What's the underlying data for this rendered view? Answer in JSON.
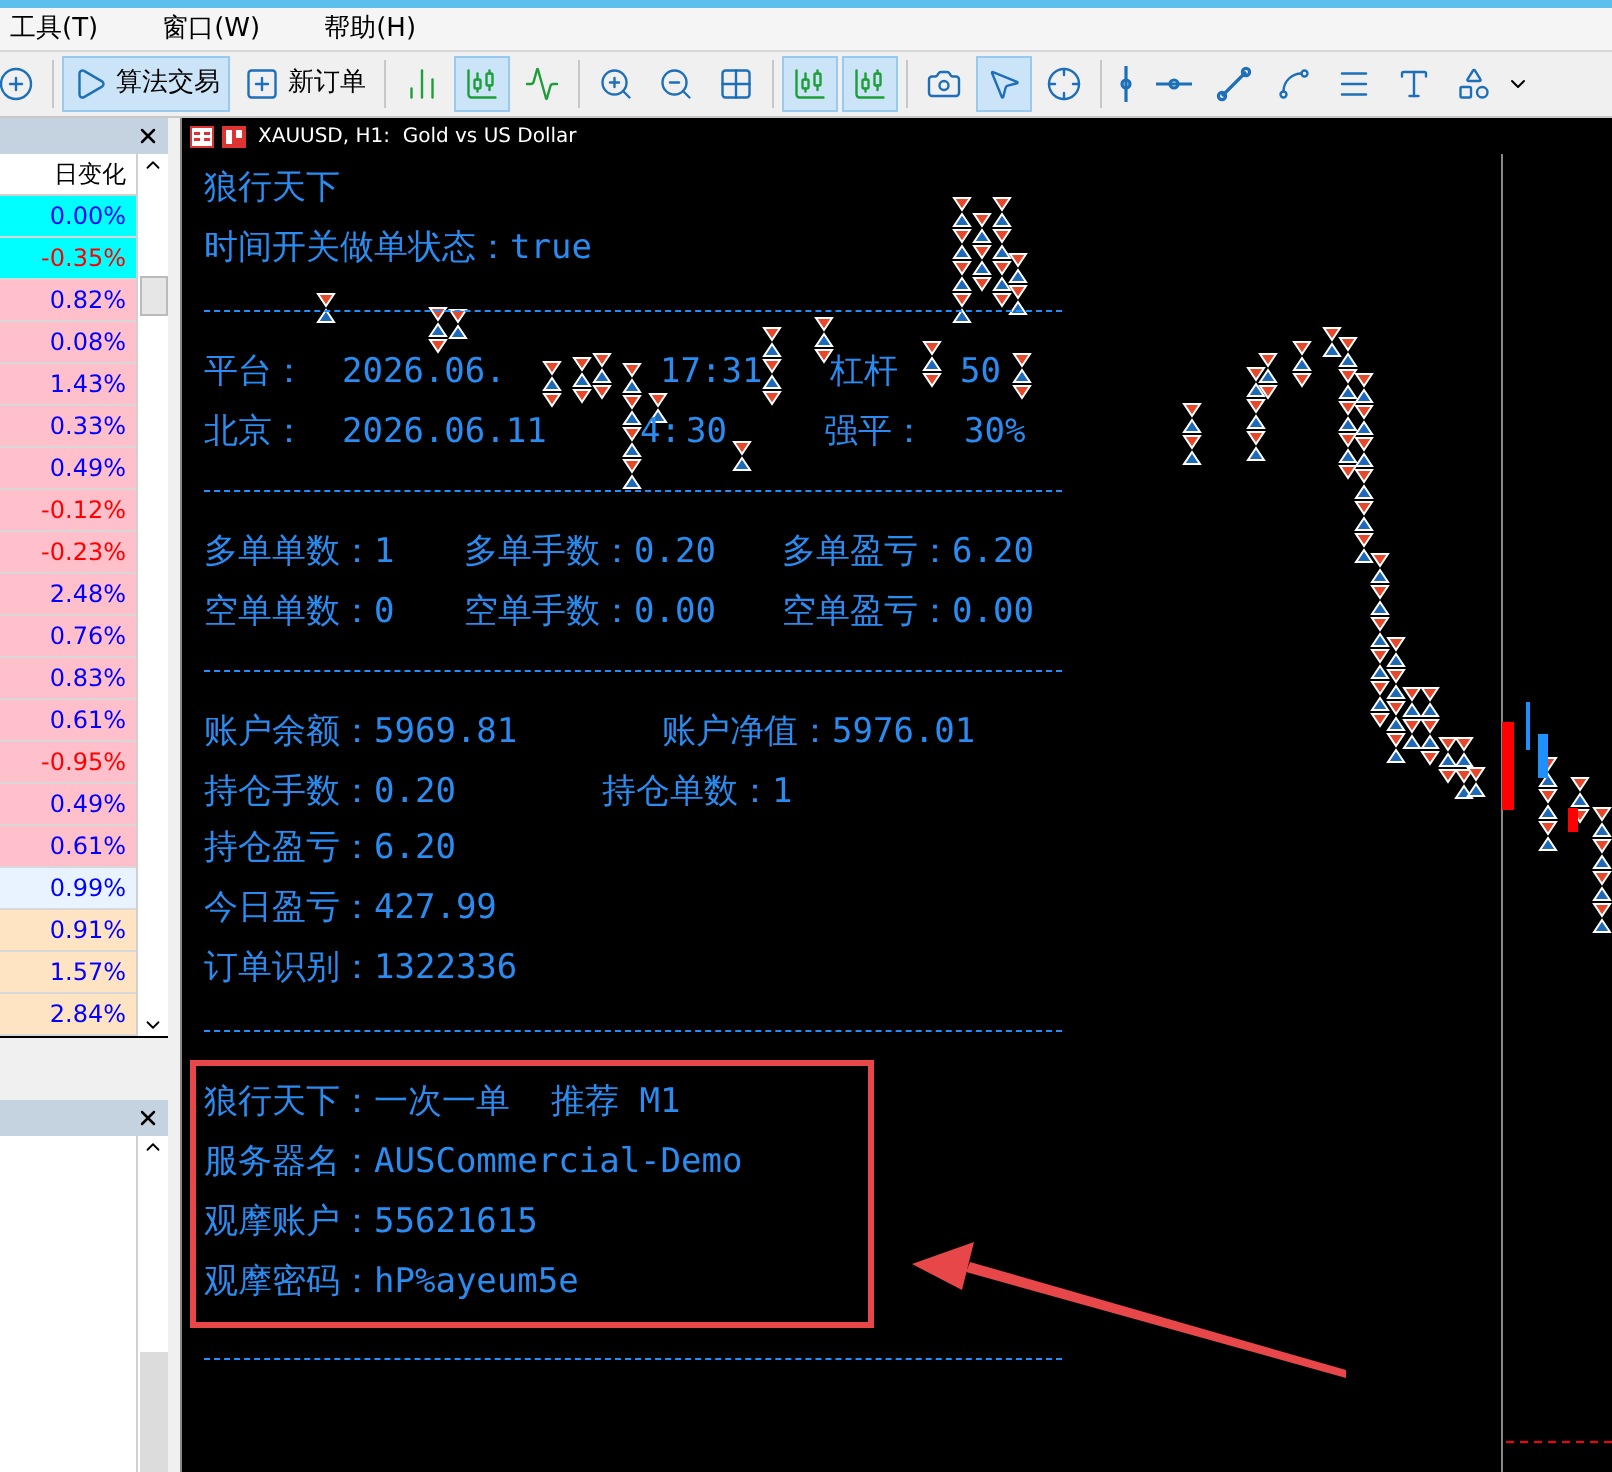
{
  "menu": [
    {
      "label": "工具(T)"
    },
    {
      "label": "窗口(W)"
    },
    {
      "label": "帮助(H)"
    }
  ],
  "toolbar": [
    {
      "selected": false
    },
    {
      "label": "算法交易",
      "selected": true
    },
    {
      "label": "新订单",
      "selected": false
    },
    {
      "selected": false
    },
    {
      "selected": true
    },
    {
      "selected": false
    },
    {
      "selected": false
    },
    {
      "selected": false
    },
    {
      "selected": false
    },
    {
      "selected": true
    },
    {
      "selected": true
    },
    {
      "selected": false
    },
    {
      "selected": true
    },
    {
      "selected": false
    },
    {
      "selected": false
    },
    {
      "selected": false
    },
    {
      "selected": false
    },
    {
      "selected": false
    },
    {
      "selected": false
    },
    {
      "selected": false
    },
    {
      "selected": false
    }
  ],
  "market_watch": {
    "column": "日变化",
    "rows": [
      {
        "value": "0.00%",
        "color": "#00ffff",
        "down": false
      },
      {
        "value": "-0.35%",
        "color": "#00ffff",
        "down": true
      },
      {
        "value": "0.82%",
        "color": "#ffc0cb",
        "down": false
      },
      {
        "value": "0.08%",
        "color": "#ffc0cb",
        "down": false
      },
      {
        "value": "1.43%",
        "color": "#ffc0cb",
        "down": false
      },
      {
        "value": "0.33%",
        "color": "#ffc0cb",
        "down": false
      },
      {
        "value": "0.49%",
        "color": "#ffc0cb",
        "down": false
      },
      {
        "value": "-0.12%",
        "color": "#ffc0cb",
        "down": true
      },
      {
        "value": "-0.23%",
        "color": "#ffc0cb",
        "down": true
      },
      {
        "value": "2.48%",
        "color": "#ffc0cb",
        "down": false
      },
      {
        "value": "0.76%",
        "color": "#ffc0cb",
        "down": false
      },
      {
        "value": "0.83%",
        "color": "#ffc0cb",
        "down": false
      },
      {
        "value": "0.61%",
        "color": "#ffc0cb",
        "down": false
      },
      {
        "value": "-0.95%",
        "color": "#ffc0cb",
        "down": true
      },
      {
        "value": "0.49%",
        "color": "#ffc0cb",
        "down": false
      },
      {
        "value": "0.61%",
        "color": "#ffc0cb",
        "down": false
      },
      {
        "value": "0.99%",
        "color": "#e8f3ff",
        "down": false
      },
      {
        "value": "0.91%",
        "color": "#ffe4c4",
        "down": false
      },
      {
        "value": "1.57%",
        "color": "#ffe4c4",
        "down": false
      },
      {
        "value": "2.84%",
        "color": "#ffe4c4",
        "down": false
      }
    ]
  },
  "chart": {
    "title": "XAUUSD, H1:  Gold vs US Dollar",
    "lines": [
      {
        "kind": "text",
        "highlighted": false,
        "segments": [
          "狼行天下"
        ]
      },
      {
        "kind": "text",
        "highlighted": false,
        "segments": [
          "时间开关做单状态：true"
        ]
      },
      {
        "kind": "rule",
        "highlighted": false
      },
      {
        "kind": "text",
        "highlighted": false,
        "segments": [
          "平台：",
          "2026.06.",
          "17:31",
          "杠杆",
          "50"
        ]
      },
      {
        "kind": "text",
        "highlighted": false,
        "segments": [
          "北京：",
          "2026.06.11",
          "4:",
          "30",
          "强平：",
          "30%"
        ]
      },
      {
        "kind": "rule",
        "highlighted": false
      },
      {
        "kind": "text",
        "highlighted": false,
        "segments": [
          "多单单数：1",
          "多单手数：0.20",
          "多单盈亏：6.20"
        ]
      },
      {
        "kind": "text",
        "highlighted": false,
        "segments": [
          "空单单数：0",
          "空单手数：0.00",
          "空单盈亏：0.00"
        ]
      },
      {
        "kind": "rule",
        "highlighted": false
      },
      {
        "kind": "text",
        "highlighted": false,
        "segments": [
          "账户余额：5969.81",
          "账户净值：5976.01"
        ]
      },
      {
        "kind": "text",
        "highlighted": false,
        "segments": [
          "持仓手数：0.20",
          "持仓单数：1"
        ]
      },
      {
        "kind": "text",
        "highlighted": false,
        "segments": [
          "持仓盈亏：6.20"
        ]
      },
      {
        "kind": "text",
        "highlighted": false,
        "segments": [
          "今日盈亏：427.99"
        ]
      },
      {
        "kind": "text",
        "highlighted": false,
        "segments": [
          "订单识别：1322336"
        ]
      },
      {
        "kind": "rule",
        "highlighted": false
      },
      {
        "kind": "text",
        "highlighted": true,
        "segments": [
          "狼行天下：一次一单  推荐 M1"
        ]
      },
      {
        "kind": "text",
        "highlighted": true,
        "segments": [
          "服务器名：AUSCommercial-Demo"
        ]
      },
      {
        "kind": "text",
        "highlighted": true,
        "segments": [
          "观摩账户：55621615"
        ]
      },
      {
        "kind": "text",
        "highlighted": true,
        "segments": [
          "观摩密码：hP%ayeum5e"
        ]
      },
      {
        "kind": "rule",
        "highlighted": false
      }
    ]
  }
}
